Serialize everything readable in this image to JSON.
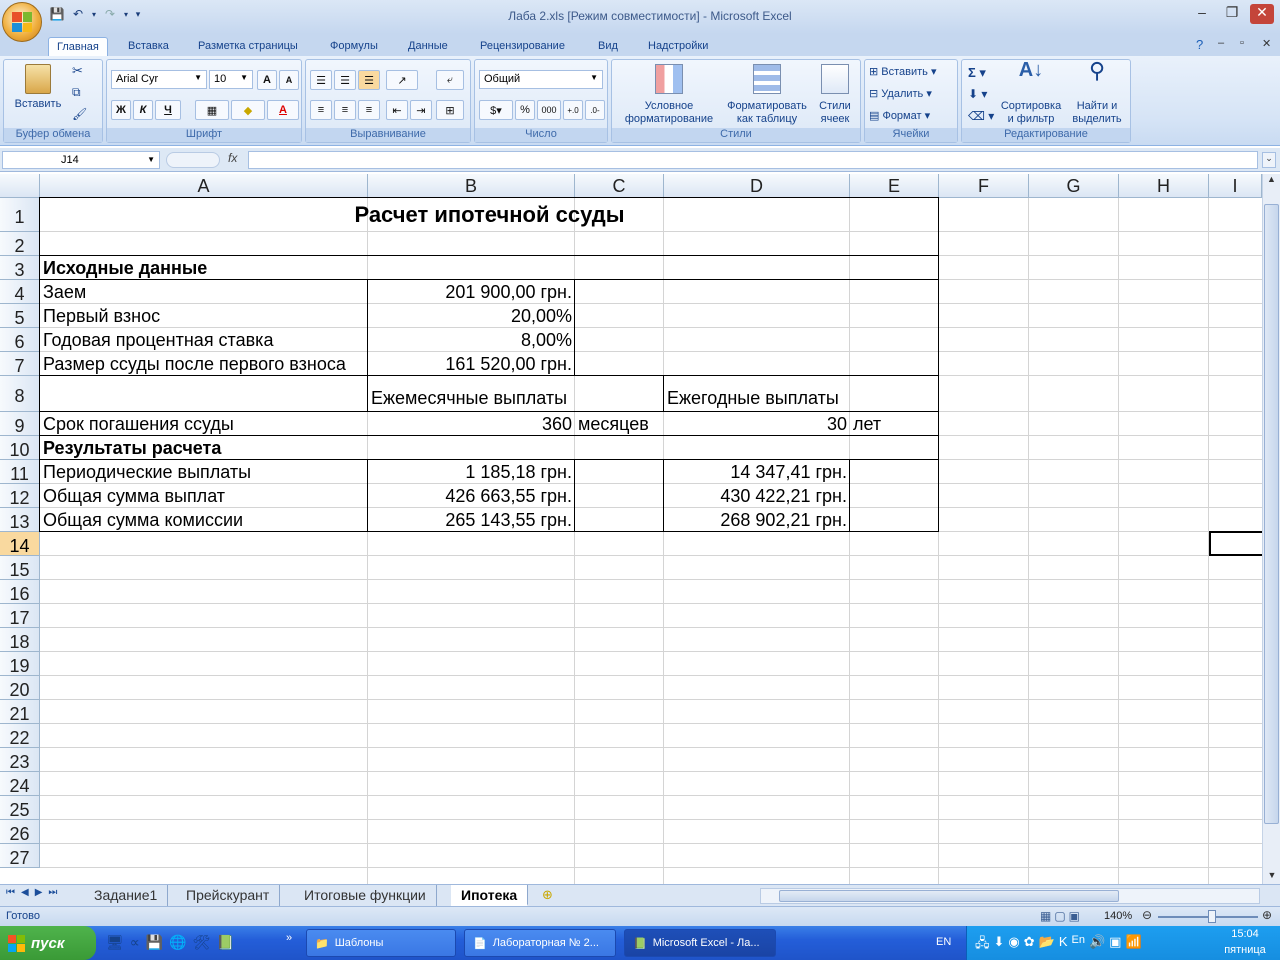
{
  "window": {
    "title": "Лаба 2.xls  [Режим совместимости] - Microsoft Excel"
  },
  "ribbon_tabs": [
    "Главная",
    "Вставка",
    "Разметка страницы",
    "Формулы",
    "Данные",
    "Рецензирование",
    "Вид",
    "Надстройки"
  ],
  "ribbon": {
    "clipboard": {
      "paste": "Вставить",
      "label": "Буфер обмена"
    },
    "font": {
      "name": "Arial Cyr",
      "size": "10",
      "bold": "Ж",
      "italic": "К",
      "underline": "Ч",
      "label": "Шрифт"
    },
    "alignment": {
      "label": "Выравнивание"
    },
    "number": {
      "format": "Общий",
      "percent": "%",
      "thousands": "000",
      "label": "Число"
    },
    "styles": {
      "conditional1": "Условное",
      "conditional2": "форматирование",
      "astable1": "Форматировать",
      "astable2": "как таблицу",
      "cellstyles1": "Стили",
      "cellstyles2": "ячеек",
      "label": "Стили"
    },
    "cells": {
      "insert": "Вставить",
      "delete": "Удалить",
      "format": "Формат",
      "label": "Ячейки"
    },
    "editing": {
      "sort1": "Сортировка",
      "sort2": "и фильтр",
      "find1": "Найти и",
      "find2": "выделить",
      "label": "Редактирование"
    }
  },
  "formula_bar": {
    "name_box": "J14",
    "fx": "fx",
    "value": ""
  },
  "columns": [
    "A",
    "B",
    "C",
    "D",
    "E",
    "F",
    "G",
    "H",
    "I"
  ],
  "rows": [
    "1",
    "2",
    "3",
    "4",
    "5",
    "6",
    "7",
    "8",
    "9",
    "10",
    "11",
    "12",
    "13",
    "14",
    "15",
    "16",
    "17",
    "18",
    "19",
    "20",
    "21",
    "22",
    "23",
    "24",
    "25",
    "26",
    "27"
  ],
  "cells": {
    "A1": "Расчет ипотечной ссуды",
    "A3": "Исходные данные",
    "A4": "Заем",
    "B4": "201 900,00 грн.",
    "A5": "Первый взнос",
    "B5": "20,00%",
    "A6": "Годовая процентная ставка",
    "B6": "8,00%",
    "A7": "Размер ссуды после первого взноса",
    "B7": "161 520,00 грн.",
    "B8": "Ежемесячные выплаты",
    "D8": "Ежегодные выплаты",
    "A9": "Срок погашения ссуды",
    "B9": "360",
    "C9": "месяцев",
    "D9": "30",
    "E9": "лет",
    "A10": "Результаты расчета",
    "A11": "Периодические выплаты",
    "B11": "1 185,18 грн.",
    "D11": "14 347,41 грн.",
    "A12": "Общая сумма выплат",
    "B12": "426 663,55 грн.",
    "D12": "430 422,21 грн.",
    "A13": "Общая сумма комиссии",
    "B13": "265 143,55 грн.",
    "D13": "268 902,21 грн."
  },
  "sheets": [
    "Задание1",
    "Прейскурант",
    "Итоговые функции",
    "Ипотека"
  ],
  "active_sheet": "Ипотека",
  "status": {
    "ready": "Готово",
    "zoom": "140%"
  },
  "taskbar": {
    "start": "пуск",
    "tasks": [
      "Шаблоны",
      "Лабораторная № 2...",
      "Microsoft Excel - Ла..."
    ],
    "lang": "EN",
    "tray_lang": "En",
    "time": "15:04",
    "day": "пятница"
  }
}
